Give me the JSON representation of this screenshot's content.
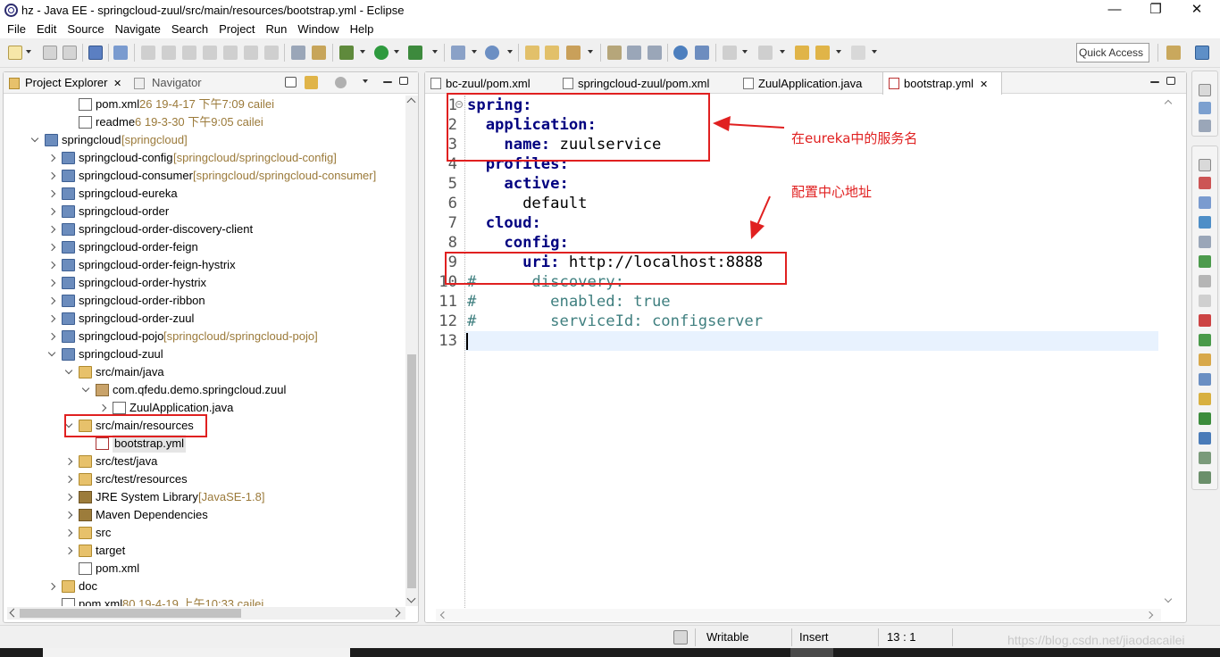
{
  "window": {
    "title": "hz - Java EE - springcloud-zuul/src/main/resources/bootstrap.yml - Eclipse",
    "minimize": "—",
    "restore": "❐",
    "close": "✕"
  },
  "menu": [
    "File",
    "Edit",
    "Source",
    "Navigate",
    "Search",
    "Project",
    "Run",
    "Window",
    "Help"
  ],
  "quick_access": "Quick Access",
  "left_panel": {
    "tabs": [
      {
        "label": "Project Explorer",
        "close": "✕"
      },
      {
        "label": "Navigator"
      }
    ],
    "tree": [
      {
        "indent": 3,
        "icon": "xml",
        "label": "pom.xml",
        "deco": " 26  19-4-17 下午7:09  cailei",
        "twisty": "none"
      },
      {
        "indent": 3,
        "icon": "xml",
        "label": "readme",
        "deco": " 6  19-3-30 下午9:05  cailei",
        "twisty": "none"
      },
      {
        "indent": 1,
        "icon": "proj",
        "label": "springcloud",
        "deco": " [springcloud]",
        "twisty": "open"
      },
      {
        "indent": 2,
        "icon": "proj",
        "label": "springcloud-config",
        "deco": " [springcloud/springcloud-config]",
        "twisty": "closed"
      },
      {
        "indent": 2,
        "icon": "proj",
        "label": "springcloud-consumer",
        "deco": " [springcloud/springcloud-consumer]",
        "twisty": "closed"
      },
      {
        "indent": 2,
        "icon": "proj",
        "label": "springcloud-eureka",
        "deco": "",
        "twisty": "closed"
      },
      {
        "indent": 2,
        "icon": "proj",
        "label": "springcloud-order",
        "deco": "",
        "twisty": "closed"
      },
      {
        "indent": 2,
        "icon": "proj",
        "label": "springcloud-order-discovery-client",
        "deco": "",
        "twisty": "closed"
      },
      {
        "indent": 2,
        "icon": "proj",
        "label": "springcloud-order-feign",
        "deco": "",
        "twisty": "closed"
      },
      {
        "indent": 2,
        "icon": "proj",
        "label": "springcloud-order-feign-hystrix",
        "deco": "",
        "twisty": "closed"
      },
      {
        "indent": 2,
        "icon": "proj",
        "label": "springcloud-order-hystrix",
        "deco": "",
        "twisty": "closed"
      },
      {
        "indent": 2,
        "icon": "proj",
        "label": "springcloud-order-ribbon",
        "deco": "",
        "twisty": "closed"
      },
      {
        "indent": 2,
        "icon": "proj",
        "label": "springcloud-order-zuul",
        "deco": "",
        "twisty": "closed"
      },
      {
        "indent": 2,
        "icon": "proj",
        "label": "springcloud-pojo",
        "deco": " [springcloud/springcloud-pojo]",
        "twisty": "closed"
      },
      {
        "indent": 2,
        "icon": "proj",
        "label": "springcloud-zuul",
        "deco": "",
        "twisty": "open"
      },
      {
        "indent": 3,
        "icon": "srcfolder",
        "label": "src/main/java",
        "deco": "",
        "twisty": "open"
      },
      {
        "indent": 4,
        "icon": "pkg",
        "label": "com.qfedu.demo.springcloud.zuul",
        "deco": "",
        "twisty": "open"
      },
      {
        "indent": 5,
        "icon": "java",
        "label": "ZuulApplication.java",
        "deco": "",
        "twisty": "closed"
      },
      {
        "indent": 3,
        "icon": "srcfolder",
        "label": "src/main/resources",
        "deco": "",
        "twisty": "open"
      },
      {
        "indent": 4,
        "icon": "yml",
        "label": "bootstrap.yml",
        "deco": "",
        "twisty": "none",
        "selected": true
      },
      {
        "indent": 3,
        "icon": "srcfolder",
        "label": "src/test/java",
        "deco": "",
        "twisty": "closed"
      },
      {
        "indent": 3,
        "icon": "srcfolder",
        "label": "src/test/resources",
        "deco": "",
        "twisty": "closed"
      },
      {
        "indent": 3,
        "icon": "lib",
        "label": "JRE System Library",
        "deco": " [JavaSE-1.8]",
        "twisty": "closed"
      },
      {
        "indent": 3,
        "icon": "lib",
        "label": "Maven Dependencies",
        "deco": "",
        "twisty": "closed"
      },
      {
        "indent": 3,
        "icon": "folder",
        "label": "src",
        "deco": "",
        "twisty": "closed"
      },
      {
        "indent": 3,
        "icon": "folder",
        "label": "target",
        "deco": "",
        "twisty": "closed"
      },
      {
        "indent": 3,
        "icon": "xml",
        "label": "pom.xml",
        "deco": "",
        "twisty": "none"
      },
      {
        "indent": 2,
        "icon": "folder",
        "label": "doc",
        "deco": "",
        "twisty": "closed"
      },
      {
        "indent": 2,
        "icon": "xml",
        "label": "pom.xml",
        "deco": " 80  19-4-19 上午10:33  cailei",
        "twisty": "none"
      }
    ]
  },
  "editor": {
    "tabs": [
      {
        "label": "bc-zuul/pom.xml",
        "active": false
      },
      {
        "label": "springcloud-zuul/pom.xml",
        "active": false
      },
      {
        "label": "ZuulApplication.java",
        "active": false
      },
      {
        "label": "bootstrap.yml",
        "active": true,
        "close": "✕"
      }
    ],
    "lines": [
      {
        "n": "1",
        "parts": [
          {
            "t": "spring:",
            "c": "key"
          }
        ],
        "fold": true
      },
      {
        "n": "2",
        "parts": [
          {
            "t": "  ",
            "c": "val"
          },
          {
            "t": "application:",
            "c": "key"
          }
        ]
      },
      {
        "n": "3",
        "parts": [
          {
            "t": "    ",
            "c": "val"
          },
          {
            "t": "name:",
            "c": "key"
          },
          {
            "t": " zuulservice",
            "c": "val"
          }
        ]
      },
      {
        "n": "4",
        "parts": [
          {
            "t": "  ",
            "c": "val"
          },
          {
            "t": "profiles:",
            "c": "key"
          }
        ]
      },
      {
        "n": "5",
        "parts": [
          {
            "t": "    ",
            "c": "val"
          },
          {
            "t": "active:",
            "c": "key"
          }
        ]
      },
      {
        "n": "6",
        "parts": [
          {
            "t": "      default",
            "c": "val"
          }
        ]
      },
      {
        "n": "7",
        "parts": [
          {
            "t": "  ",
            "c": "val"
          },
          {
            "t": "cloud:",
            "c": "key"
          }
        ]
      },
      {
        "n": "8",
        "parts": [
          {
            "t": "    ",
            "c": "val"
          },
          {
            "t": "config:",
            "c": "key"
          }
        ]
      },
      {
        "n": "9",
        "parts": [
          {
            "t": "      ",
            "c": "val"
          },
          {
            "t": "uri:",
            "c": "key"
          },
          {
            "t": " http://localhost:8888",
            "c": "val"
          }
        ]
      },
      {
        "n": "10",
        "parts": [
          {
            "t": "#      discovery:",
            "c": "cmt"
          }
        ]
      },
      {
        "n": "11",
        "parts": [
          {
            "t": "#        enabled: true",
            "c": "cmt"
          }
        ]
      },
      {
        "n": "12",
        "parts": [
          {
            "t": "#        serviceId: configserver",
            "c": "cmt"
          }
        ]
      },
      {
        "n": "13",
        "parts": [
          {
            "t": "",
            "c": "val"
          }
        ]
      }
    ]
  },
  "annotations": {
    "service_name": "在eureka中的服务名",
    "config_center": "配置中心地址",
    "color": "#e02020"
  },
  "status": {
    "writable": "Writable",
    "insert": "Insert",
    "position": "13 : 1"
  },
  "watermark": "https://blog.csdn.net/jiaodacailei",
  "colors": {
    "yaml_key": "#000080",
    "comment": "#3f7f7f",
    "current_line": "#e8f2fe"
  }
}
